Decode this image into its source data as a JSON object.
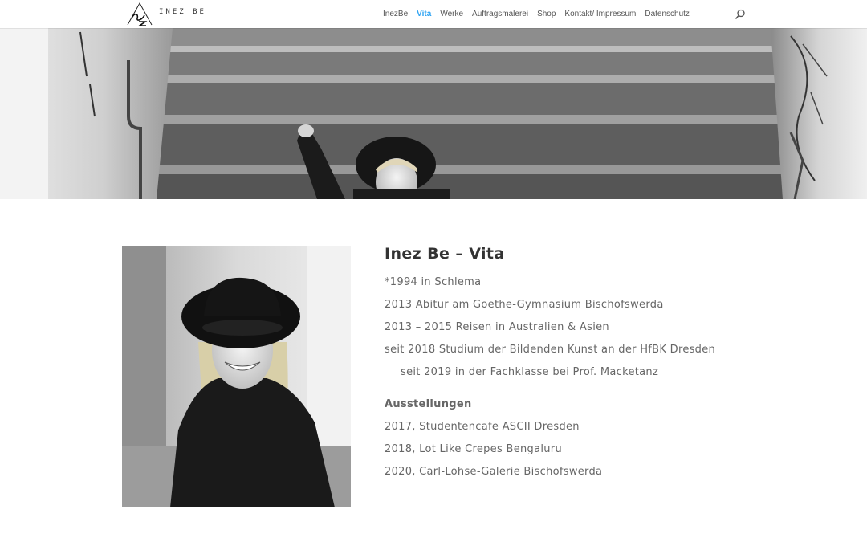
{
  "header": {
    "logo_text": "INEZ BE",
    "nav": [
      {
        "label": "InezBe",
        "active": false
      },
      {
        "label": "Vita",
        "active": true
      },
      {
        "label": "Werke",
        "active": false
      },
      {
        "label": "Auftragsmalerei",
        "active": false
      },
      {
        "label": "Shop",
        "active": false
      },
      {
        "label": "Kontakt/ Impressum",
        "active": false
      },
      {
        "label": "Datenschutz",
        "active": false
      }
    ],
    "accent_color": "#2ea3f2"
  },
  "vita": {
    "title": "Inez Be – Vita",
    "lines": [
      "*1994 in Schlema",
      "2013 Abitur am Goethe-Gymnasium Bischofswerda",
      "2013 – 2015 Reisen in Australien & Asien",
      "seit 2018 Studium der Bildenden Kunst an der HfBK Dresden",
      "seit 2019 in der Fachklasse bei Prof. Macketanz"
    ],
    "exhibitions_heading": "Ausstellungen",
    "exhibitions": [
      "2017, Studentencafe ASCII Dresden",
      "2018, Lot Like Crepes Bengaluru",
      "2020, Carl-Lohse-Galerie Bischofswerda"
    ]
  }
}
